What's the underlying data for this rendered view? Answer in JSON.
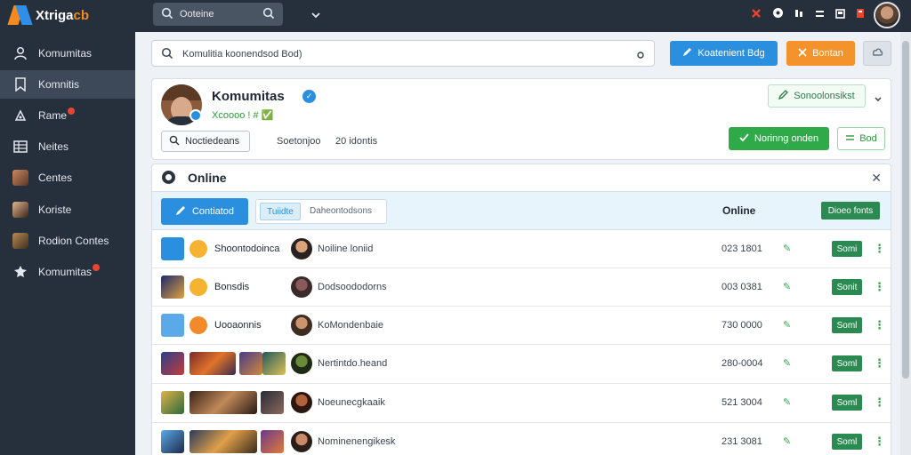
{
  "app": {
    "logo_text": "Xtriga",
    "logo_accent": "cb",
    "brand_colors": {
      "orange": "#f58a1f",
      "blue": "#2f8fe6"
    }
  },
  "topbar": {
    "search_label": "Ooteine",
    "icons": [
      "x-icon",
      "compass-icon",
      "music-icon",
      "list-icon",
      "image-icon",
      "bookmark-icon"
    ]
  },
  "sidebar": {
    "items": [
      {
        "label": "Komumitas",
        "icon": "user-icon"
      },
      {
        "label": "Komnitis",
        "icon": "bookmark-icon"
      },
      {
        "label": "Rame",
        "icon": "palette-icon",
        "dot": true
      },
      {
        "label": "Neites",
        "icon": "grid-icon"
      },
      {
        "label": "Centes",
        "icon": "avatar-thumb"
      },
      {
        "label": "Koriste",
        "icon": "avatar-thumb"
      },
      {
        "label": "Rodion Contes",
        "icon": "avatar-thumb"
      },
      {
        "label": "Komumitas",
        "icon": "gear-icon",
        "dot": true
      }
    ]
  },
  "main": {
    "search_value": "Komulitia koonendsod Bod)",
    "btn_blue": "Koatenient Bdg",
    "btn_orange": "Bontan"
  },
  "profile": {
    "name": "Komumitas",
    "sub": "Xcoooo  !  #  ✅",
    "btn_label": "Noctiedeans",
    "meta1": "Soetonjoo",
    "meta2": "20 idontis",
    "select_label": "Sonoolonsikst",
    "green_btn": "Norinng onden",
    "outline_btn": "Bod"
  },
  "panel": {
    "title": "Online",
    "toolbar_btn": "Contiatod",
    "tab_active": "Tuiidte",
    "tab_other": "Daheontodsons",
    "online_label": "Online",
    "online_badge": "Dioeo fonts",
    "rows": [
      {
        "name1": "Shoontodoinca",
        "name2": "Noiline loniid",
        "num": "023 1801",
        "badge": "Somi"
      },
      {
        "name1": "Bonsdis",
        "name2": "Dodsoododorns",
        "num": "003 0381",
        "badge": "Sonit"
      },
      {
        "name1": "Uooaonnis",
        "name2": "KoMondenbaie",
        "num": "730 0000",
        "badge": "Soml"
      },
      {
        "name1": "",
        "name2": "Nertintdo.heand",
        "num": "280-0004",
        "badge": "Soml"
      },
      {
        "name1": "",
        "name2": "Noeunecgkaaik",
        "num": "521 3004",
        "badge": "Soml"
      },
      {
        "name1": "",
        "name2": "Nominenengikesk",
        "num": "231 3081",
        "badge": "Soml"
      }
    ]
  }
}
